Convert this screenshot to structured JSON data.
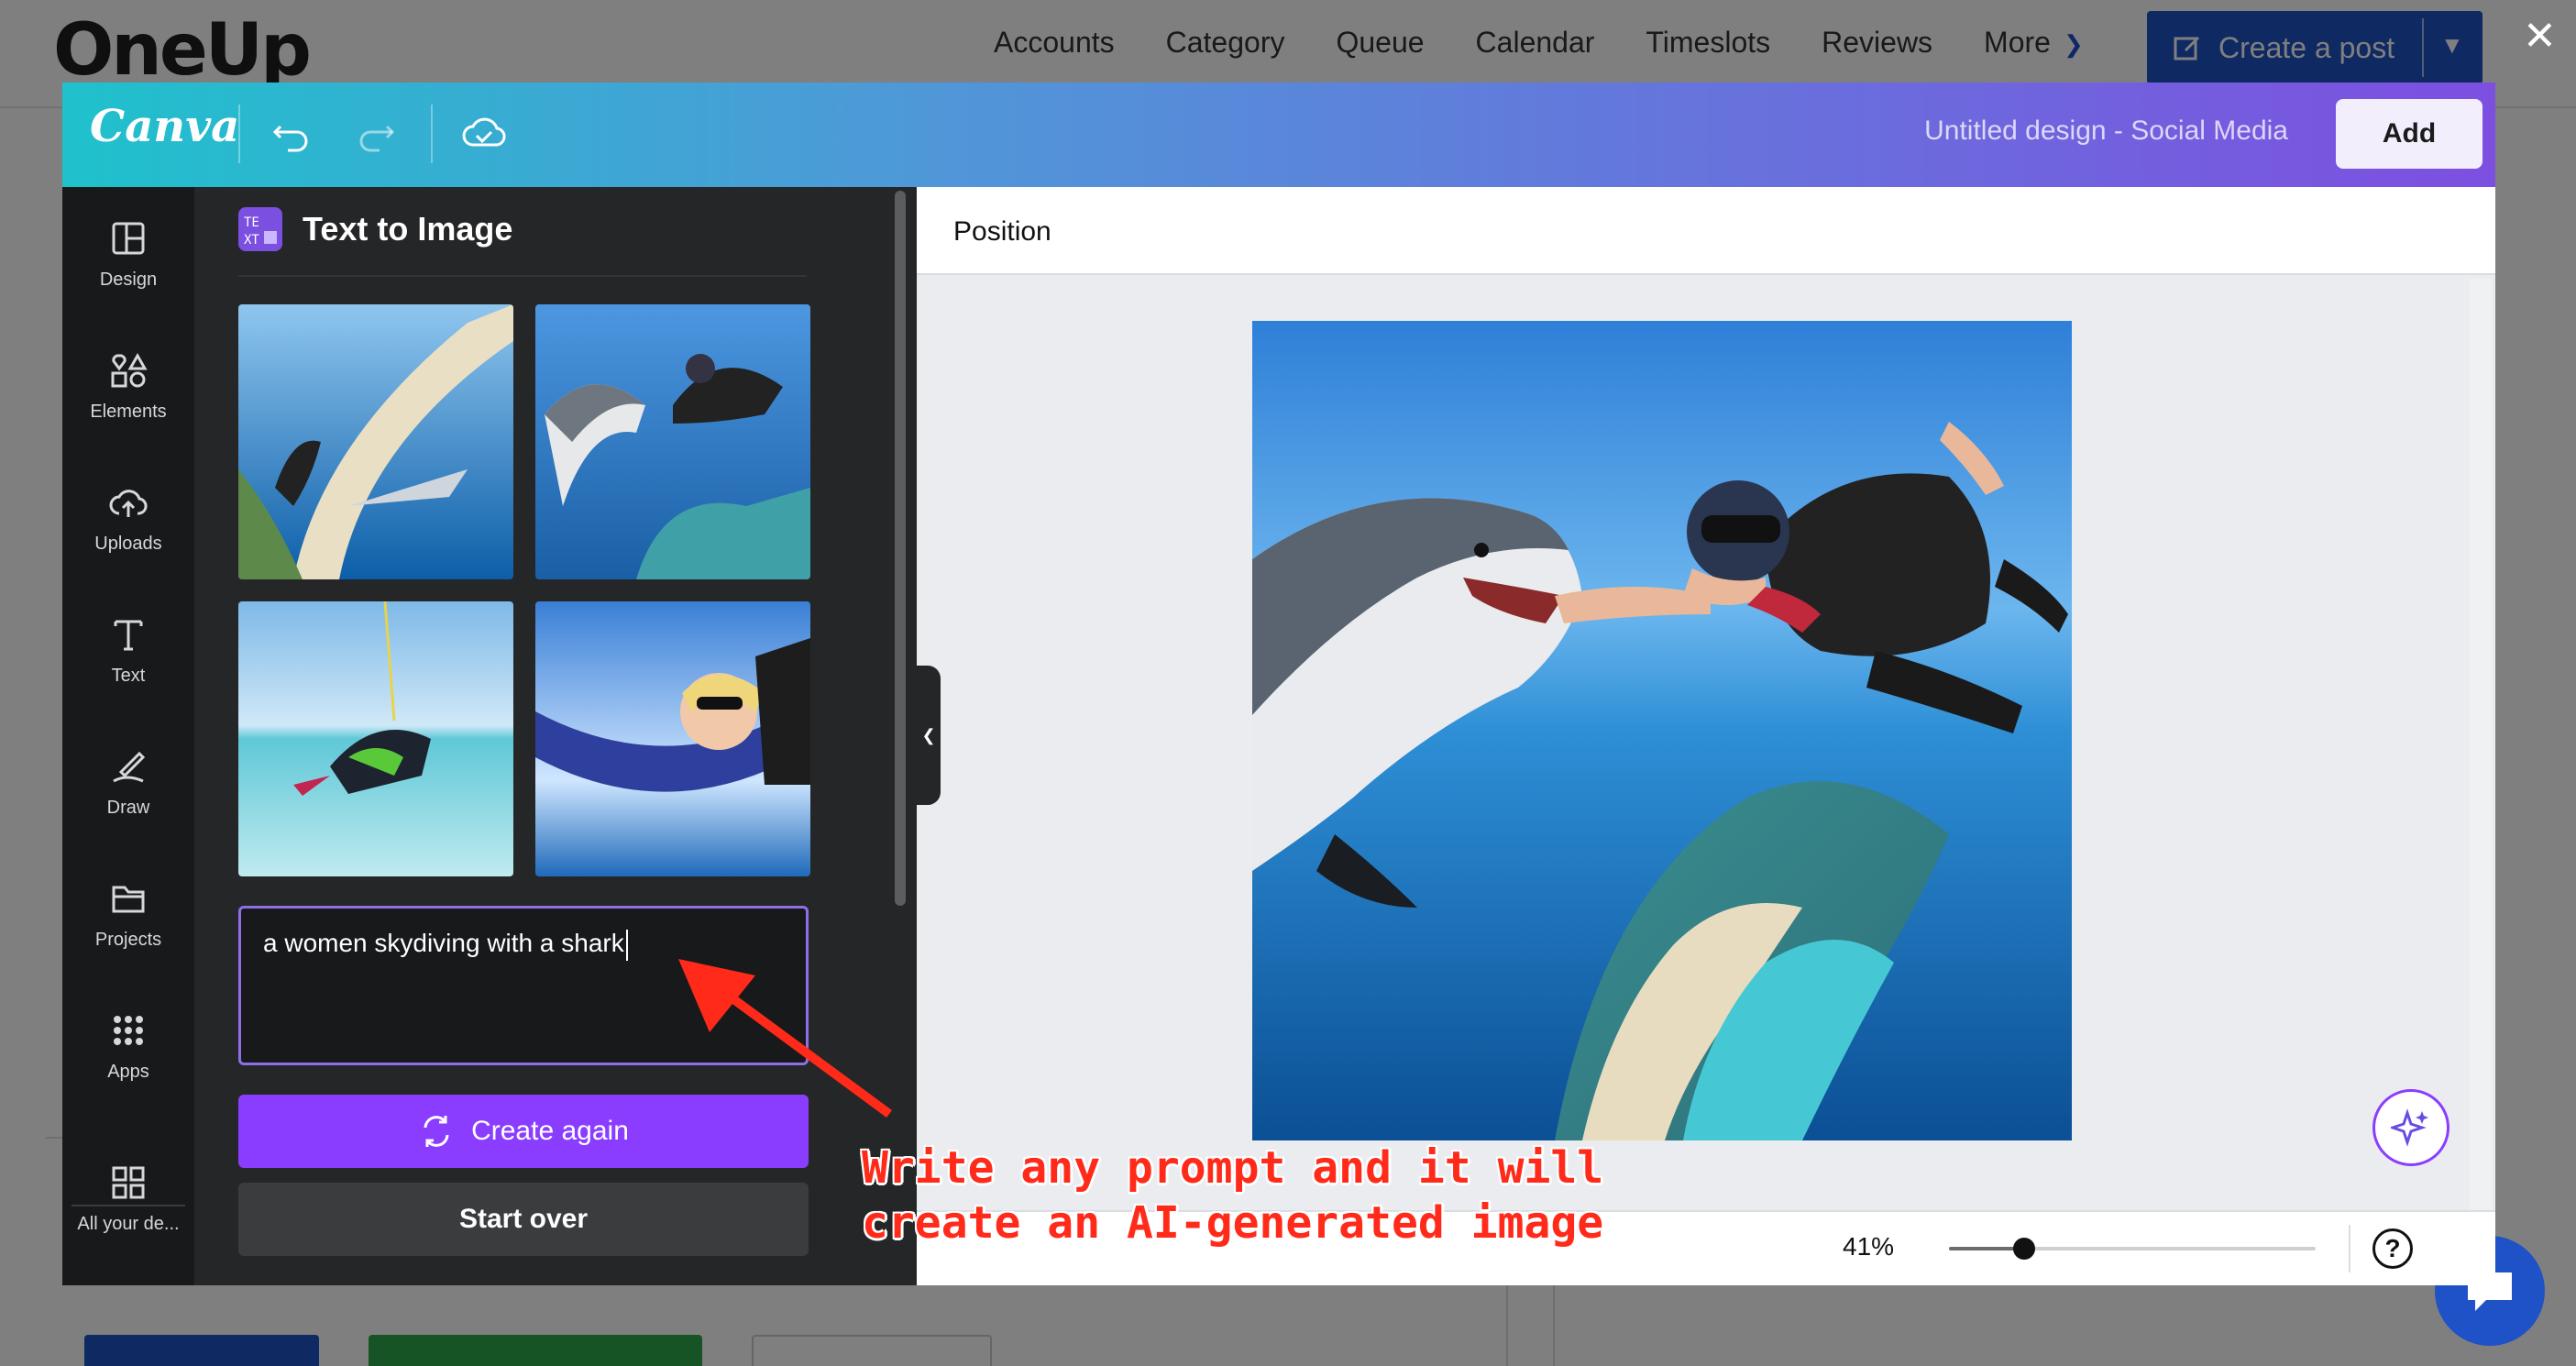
{
  "oneup": {
    "logo": "OneUp",
    "nav": [
      "Accounts",
      "Category",
      "Queue",
      "Calendar",
      "Timeslots",
      "Reviews",
      "More"
    ],
    "create_post": "Create a post",
    "close_icon": "close-icon"
  },
  "canva": {
    "logo": "Canva",
    "design_title": "Untitled design - Social Media",
    "add_button": "Add",
    "rail": [
      {
        "label": "Design",
        "icon": "design-layout-icon"
      },
      {
        "label": "Elements",
        "icon": "elements-shapes-icon"
      },
      {
        "label": "Uploads",
        "icon": "cloud-upload-icon"
      },
      {
        "label": "Text",
        "icon": "text-t-icon"
      },
      {
        "label": "Draw",
        "icon": "pen-draw-icon"
      },
      {
        "label": "Projects",
        "icon": "folder-icon"
      },
      {
        "label": "Apps",
        "icon": "apps-grid-icon"
      },
      {
        "label": "All your de...",
        "icon": "all-designs-grid-icon"
      }
    ],
    "panel": {
      "title": "Text to Image",
      "prompt": "a women skydiving with a shark",
      "create_again": "Create again",
      "start_over": "Start over"
    },
    "position_label": "Position",
    "zoom": "41%",
    "zoom_level": 0.41,
    "help": "?"
  },
  "annotation": "Write any prompt and it will\ncreate an AI-generated image",
  "colors": {
    "accent_purple": "#8b3dff",
    "annotation_red": "#ff2a1a",
    "oneup_blue": "#1f52c7"
  }
}
